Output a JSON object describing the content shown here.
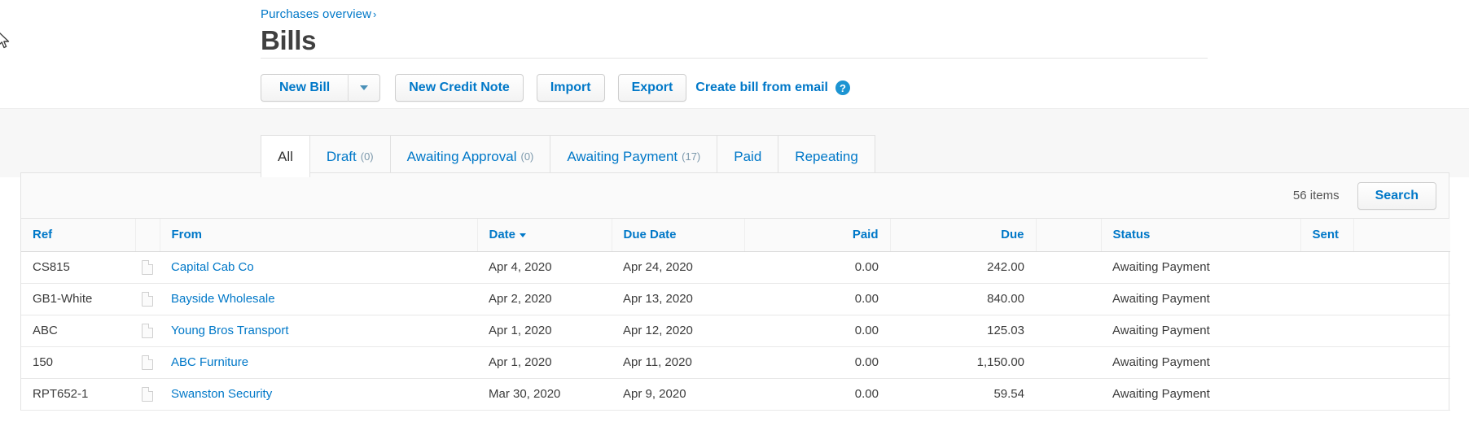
{
  "breadcrumb": {
    "label": "Purchases overview",
    "separator": "›"
  },
  "page_title": "Bills",
  "toolbar": {
    "new_bill_label": "New Bill",
    "new_bill_caret_name": "chevron-down-icon",
    "new_credit_note_label": "New Credit Note",
    "import_label": "Import",
    "export_label": "Export",
    "create_bill_from_email_label": "Create bill from email",
    "help_glyph": "?"
  },
  "tabs": [
    {
      "label": "All",
      "count": "",
      "active": true
    },
    {
      "label": "Draft",
      "count": "(0)",
      "active": false
    },
    {
      "label": "Awaiting Approval",
      "count": "(0)",
      "active": false
    },
    {
      "label": "Awaiting Payment",
      "count": "(17)",
      "active": false
    },
    {
      "label": "Paid",
      "count": "",
      "active": false
    },
    {
      "label": "Repeating",
      "count": "",
      "active": false
    }
  ],
  "card_toolbar": {
    "items_count": "56 items",
    "search_label": "Search"
  },
  "table": {
    "columns": [
      {
        "key": "ref",
        "label": "Ref",
        "align": "left"
      },
      {
        "key": "icon",
        "label": "",
        "align": "left"
      },
      {
        "key": "from",
        "label": "From",
        "align": "left"
      },
      {
        "key": "date",
        "label": "Date",
        "align": "left",
        "sorted": true,
        "sort_dir": "desc"
      },
      {
        "key": "due_date",
        "label": "Due Date",
        "align": "left"
      },
      {
        "key": "paid",
        "label": "Paid",
        "align": "right"
      },
      {
        "key": "due",
        "label": "Due",
        "align": "right"
      },
      {
        "key": "spacer",
        "label": "",
        "align": "left"
      },
      {
        "key": "status",
        "label": "Status",
        "align": "left"
      },
      {
        "key": "sent",
        "label": "Sent",
        "align": "left"
      },
      {
        "key": "end",
        "label": "",
        "align": "left"
      }
    ],
    "rows": [
      {
        "ref": "CS815",
        "icon": "document-icon",
        "from": "Capital Cab Co",
        "date": "Apr 4, 2020",
        "due_date": "Apr 24, 2020",
        "paid": "0.00",
        "due": "242.00",
        "status": "Awaiting Payment",
        "sent": ""
      },
      {
        "ref": "GB1-White",
        "icon": "document-icon",
        "from": "Bayside Wholesale",
        "date": "Apr 2, 2020",
        "due_date": "Apr 13, 2020",
        "paid": "0.00",
        "due": "840.00",
        "status": "Awaiting Payment",
        "sent": ""
      },
      {
        "ref": "ABC",
        "icon": "document-icon",
        "from": "Young Bros Transport",
        "date": "Apr 1, 2020",
        "due_date": "Apr 12, 2020",
        "paid": "0.00",
        "due": "125.03",
        "status": "Awaiting Payment",
        "sent": ""
      },
      {
        "ref": "150",
        "icon": "document-icon",
        "from": "ABC Furniture",
        "date": "Apr 1, 2020",
        "due_date": "Apr 11, 2020",
        "paid": "0.00",
        "due": "1,150.00",
        "status": "Awaiting Payment",
        "sent": ""
      },
      {
        "ref": "RPT652-1",
        "icon": "document-icon",
        "from": "Swanston Security",
        "date": "Mar 30, 2020",
        "due_date": "Apr 9, 2020",
        "paid": "0.00",
        "due": "59.54",
        "status": "Awaiting Payment",
        "sent": ""
      }
    ]
  },
  "colors": {
    "link": "#0078c8",
    "title": "#404040",
    "page_bg": "#ffffff",
    "tab_strip_bg": "#f7f7f7",
    "header_bg": "#fafafa",
    "border": "#e3e3e3"
  }
}
